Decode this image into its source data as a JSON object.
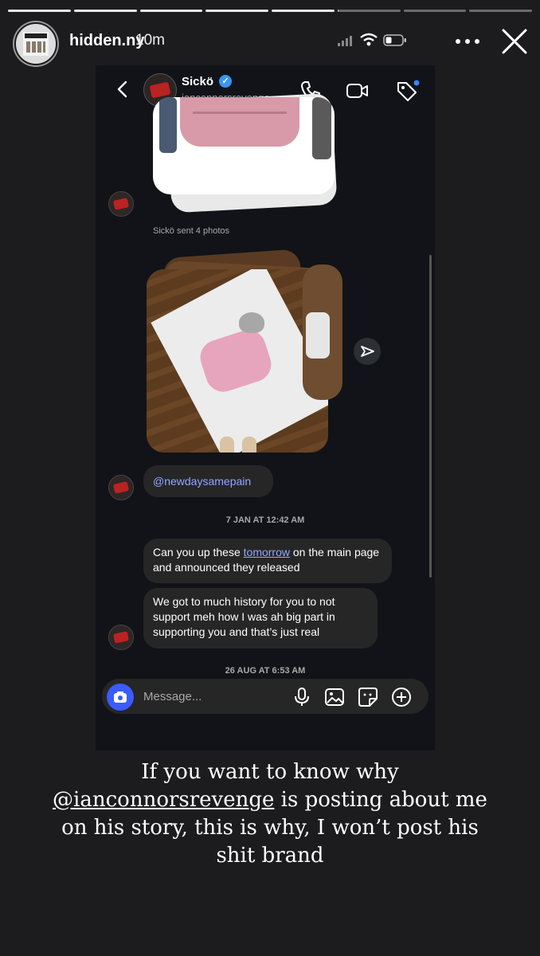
{
  "story": {
    "progress_segments": [
      1,
      1,
      1,
      1,
      1,
      0.02,
      0,
      0
    ],
    "username": "hidden.ny",
    "time_ago": "10m",
    "caption_before": "If you want to know why ",
    "caption_mention": "@ianconnorsrevenge",
    "caption_after": " is posting about me on his story, this is why, I won’t post his shit brand"
  },
  "dm": {
    "contact_name": "Sickö",
    "contact_handle": "ianconnorsrevenge",
    "verified_mark": "✓",
    "sent_photos_text": "Sickö sent 4 photos",
    "mention_message": "@newdaysamepain",
    "date_1": "7 JAN AT 12:42 AM",
    "message_1_before": "Can you up these ",
    "message_1_link": "tomorrow",
    "message_1_after": " on the main page and announced they released",
    "message_2": "We got to much history for you to not support meh how I was ah big part in supporting you and that’s just real",
    "date_2": "26 AUG AT 6:53 AM",
    "composer_placeholder": "Message..."
  },
  "icons": {
    "back": "chevron-left-icon",
    "call": "phone-icon",
    "video": "video-camera-icon",
    "tag": "tag-icon",
    "send": "send-icon",
    "camera": "camera-icon",
    "mic": "microphone-icon",
    "gallery": "image-icon",
    "sticker": "sticker-icon",
    "add": "plus-circle-icon",
    "more": "more-horizontal-icon",
    "close": "close-icon"
  },
  "colors": {
    "accent_blue": "#3b5bff",
    "link_blue": "#8fa8ff",
    "verified_blue": "#3897f0",
    "bubble": "#262626",
    "dm_background": "#111318"
  }
}
